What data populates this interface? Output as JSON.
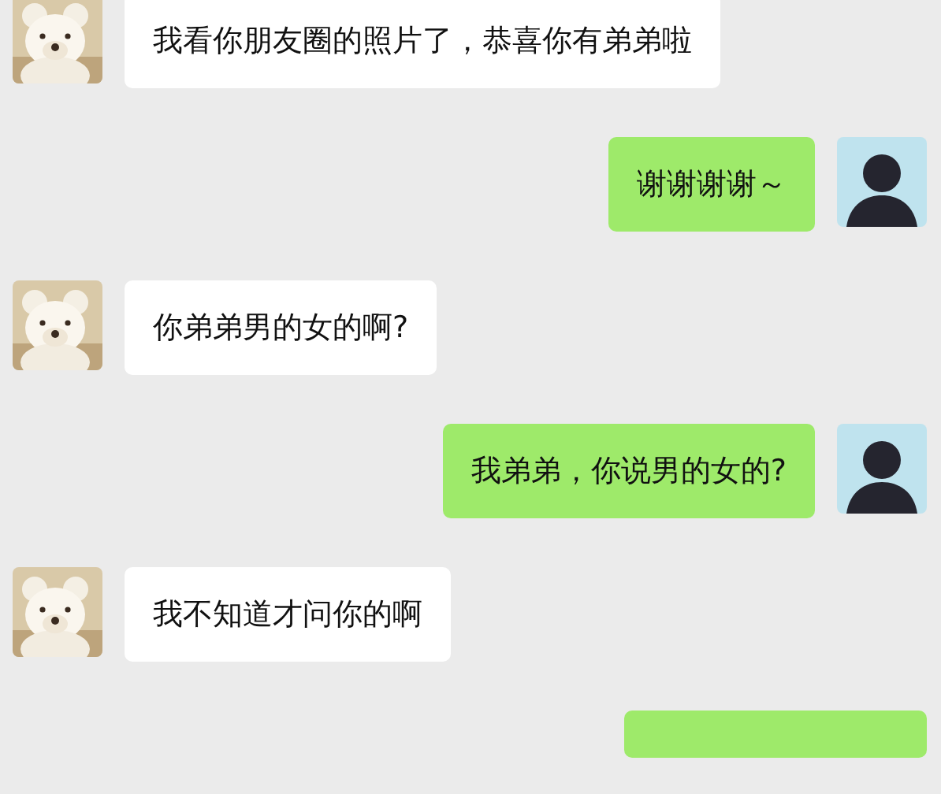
{
  "messages": [
    {
      "kind": "incoming",
      "text": "我看你朋友圈的照片了，恭喜你有弟弟啦"
    },
    {
      "kind": "outgoing",
      "text": "谢谢谢谢～"
    },
    {
      "kind": "incoming",
      "text": "你弟弟男的女的啊?"
    },
    {
      "kind": "outgoing",
      "text": "我弟弟，你说男的女的?"
    },
    {
      "kind": "incoming",
      "text": "我不知道才问你的啊"
    },
    {
      "kind": "outgoing",
      "cut": true
    }
  ]
}
